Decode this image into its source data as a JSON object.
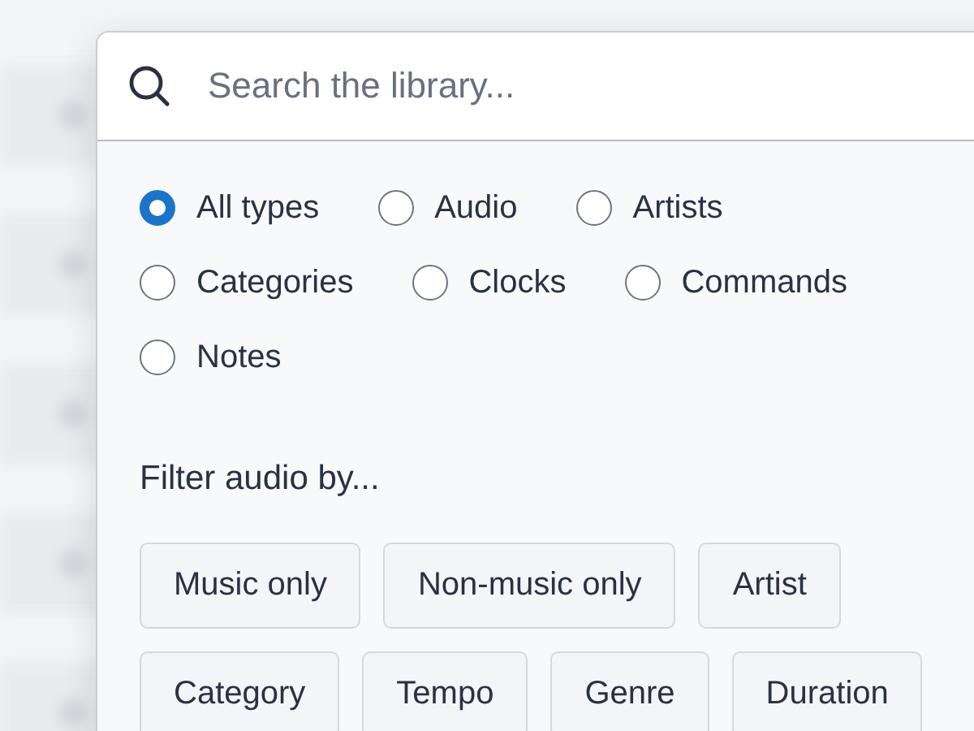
{
  "search": {
    "placeholder": "Search the library..."
  },
  "types": [
    {
      "label": "All types",
      "selected": true
    },
    {
      "label": "Audio",
      "selected": false
    },
    {
      "label": "Artists",
      "selected": false
    },
    {
      "label": "Categories",
      "selected": false
    },
    {
      "label": "Clocks",
      "selected": false
    },
    {
      "label": "Commands",
      "selected": false
    },
    {
      "label": "Notes",
      "selected": false
    }
  ],
  "filter": {
    "heading": "Filter audio by...",
    "options": [
      "Music only",
      "Non-music only",
      "Artist",
      "Category",
      "Tempo",
      "Genre",
      "Duration"
    ]
  }
}
